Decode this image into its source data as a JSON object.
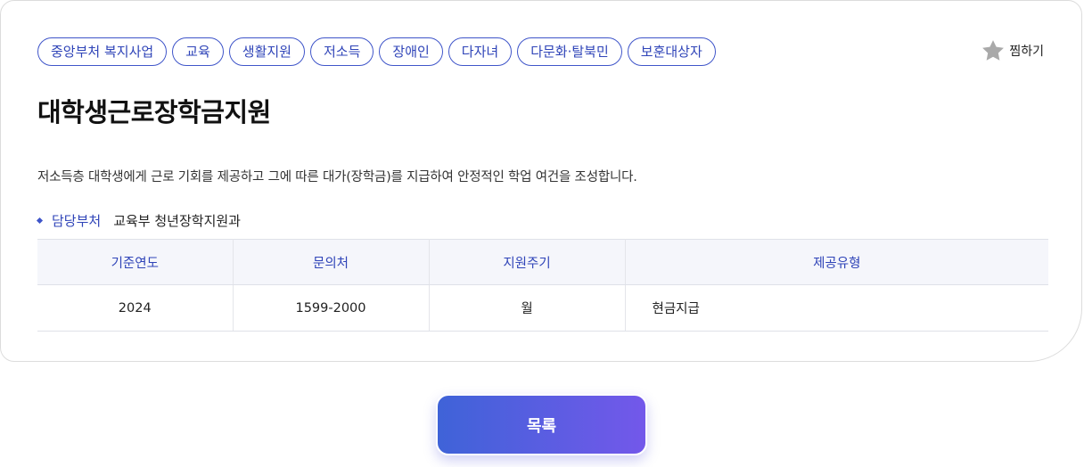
{
  "tags": [
    "중앙부처 복지사업",
    "교육",
    "생활지원",
    "저소득",
    "장애인",
    "다자녀",
    "다문화·탈북민",
    "보훈대상자"
  ],
  "favorite": {
    "label": "찜하기",
    "icon": "star-icon",
    "icon_color": "#a9a9a9"
  },
  "title": "대학생근로장학금지원",
  "description": "저소득층 대학생에게 근로 기회를 제공하고 그에 따른 대가(장학금)를 지급하여 안정적인 학업 여건을 조성합니다.",
  "department": {
    "label": "담당부처",
    "value": "교육부 청년장학지원과"
  },
  "table": {
    "headers": [
      "기준연도",
      "문의처",
      "지원주기",
      "제공유형"
    ],
    "row": [
      "2024",
      "1599-2000",
      "월",
      "현금지급"
    ]
  },
  "list_button": {
    "label": "목록"
  },
  "colors": {
    "accent": "#2f44b8",
    "button_start": "#3f63d8",
    "button_end": "#7358ea"
  }
}
